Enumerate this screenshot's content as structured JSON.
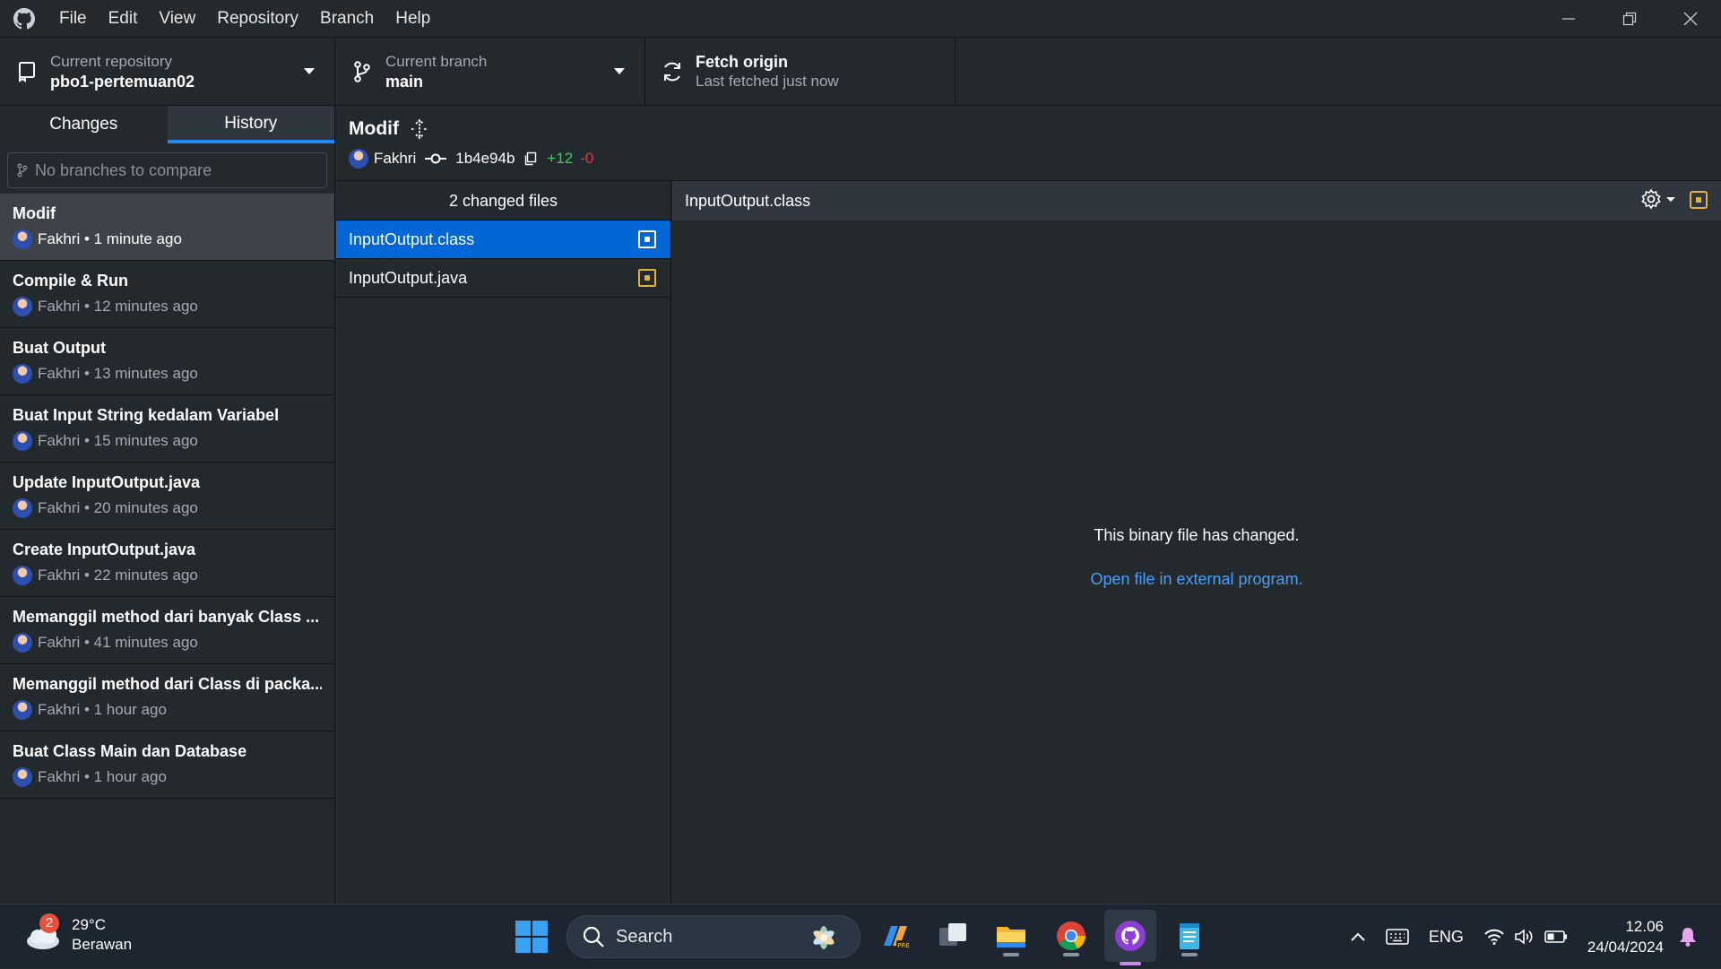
{
  "menu": [
    "File",
    "Edit",
    "View",
    "Repository",
    "Branch",
    "Help"
  ],
  "toolbar": {
    "repo_label": "Current repository",
    "repo_value": "pbo1-pertemuan02",
    "branch_label": "Current branch",
    "branch_value": "main",
    "fetch_title": "Fetch origin",
    "fetch_sub": "Last fetched just now"
  },
  "sidebar": {
    "tabs": [
      "Changes",
      "History"
    ],
    "active_tab": "History",
    "compare_placeholder": "No branches to compare",
    "commits": [
      {
        "title": "Modif",
        "meta": "Fakhri • 1 minute ago"
      },
      {
        "title": "Compile & Run",
        "meta": "Fakhri • 12 minutes ago"
      },
      {
        "title": "Buat Output",
        "meta": "Fakhri • 13 minutes ago"
      },
      {
        "title": "Buat Input String kedalam Variabel",
        "meta": "Fakhri • 15 minutes ago"
      },
      {
        "title": "Update InputOutput.java",
        "meta": "Fakhri • 20 minutes ago"
      },
      {
        "title": "Create InputOutput.java",
        "meta": "Fakhri • 22 minutes ago"
      },
      {
        "title": "Memanggil method dari banyak Class ...",
        "meta": "Fakhri • 41 minutes ago"
      },
      {
        "title": "Memanggil method dari Class di packa...",
        "meta": "Fakhri • 1 hour ago"
      },
      {
        "title": "Buat Class Main dan Database",
        "meta": "Fakhri • 1 hour ago"
      }
    ]
  },
  "commit": {
    "title": "Modif",
    "author": "Fakhri",
    "sha": "1b4e94b",
    "additions": "+12",
    "deletions": "-0"
  },
  "files": {
    "header": "2 changed files",
    "items": [
      "InputOutput.class",
      "InputOutput.java"
    ]
  },
  "diff": {
    "filename": "InputOutput.class",
    "message": "This binary file has changed.",
    "link": "Open file in external program."
  },
  "taskbar": {
    "temperature": "29°C",
    "condition": "Berawan",
    "weather_badge": "2",
    "search": "Search",
    "language": "ENG",
    "time": "12.06",
    "date": "24/04/2024"
  },
  "colors": {
    "accent": "#0366d6",
    "tab_underline": "#2188ff",
    "additions": "#34d058",
    "deletions": "#d73a49",
    "modified": "#e0b33a",
    "link": "#4a9ff5"
  }
}
